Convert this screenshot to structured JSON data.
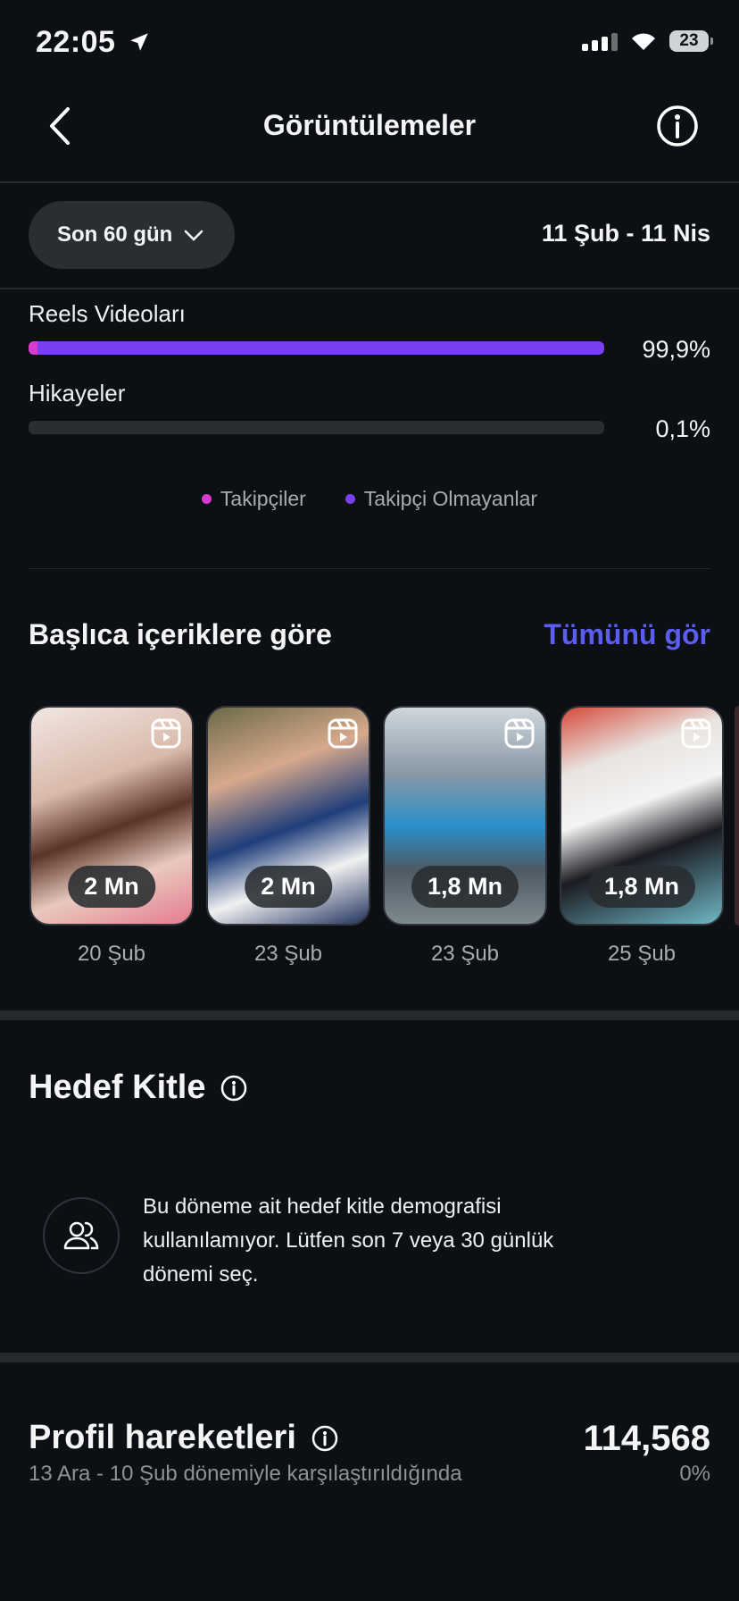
{
  "status_bar": {
    "time": "22:05",
    "battery": "23"
  },
  "header": {
    "title": "Görüntülemeler"
  },
  "range": {
    "selector_label": "Son 60 gün",
    "dates": "11 Şub - 11 Nis"
  },
  "breakdown": {
    "items": [
      {
        "label": "Reels Videoları",
        "percent": "99,9%",
        "followers_fraction": 0.016,
        "non_followers_fraction": 0.984,
        "total_fraction": 1.0
      },
      {
        "label": "Hikayeler",
        "percent": "0,1%",
        "followers_fraction": 0.0,
        "non_followers_fraction": 0.0,
        "total_fraction": 0.001
      }
    ],
    "legend": [
      {
        "label": "Takipçiler",
        "color": "#d63ccf"
      },
      {
        "label": "Takipçi Olmayanlar",
        "color": "#7b3ff2"
      }
    ]
  },
  "top_content": {
    "title": "Başlıca içeriklere göre",
    "see_all": "Tümünü gör",
    "items": [
      {
        "views": "2 Mn",
        "date": "20 Şub",
        "icon": "reels-icon"
      },
      {
        "views": "2 Mn",
        "date": "23 Şub",
        "icon": "reels-icon"
      },
      {
        "views": "1,8 Mn",
        "date": "23 Şub",
        "icon": "reels-icon"
      },
      {
        "views": "1,8 Mn",
        "date": "25 Şub",
        "icon": "reels-icon"
      }
    ]
  },
  "audience": {
    "title": "Hedef Kitle",
    "message": "Bu döneme ait hedef kitle demografisi kullanılamıyor. Lütfen son 7 veya 30 günlük dönemi seç.",
    "icon": "people-icon"
  },
  "profile_activity": {
    "title": "Profil hareketleri",
    "value": "114,568",
    "comparison": "13 Ara - 10 Şub dönemiyle karşılaştırıldığında",
    "change": "0%"
  },
  "colors": {
    "accent": "#5b5cf0",
    "background": "#0c1014"
  }
}
